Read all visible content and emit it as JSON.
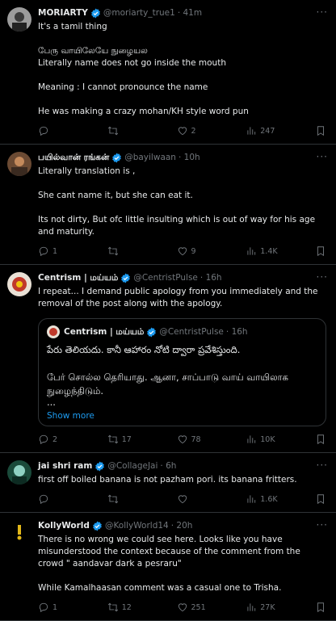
{
  "tweets": [
    {
      "name": "MORIARTY",
      "handle": "@moriarty_true1",
      "time": "· 41m",
      "lines": [
        "It's a tamil thing",
        "",
        "பேரு வாயிலேயே நுழையல",
        "Literally name does not go inside the mouth",
        "",
        "Meaning : I cannot pronounce the name",
        "",
        "He was making a crazy mohan/KH style word pun"
      ],
      "replies": "",
      "retweets": "",
      "likes": "2",
      "views": "247"
    },
    {
      "name": "பயில்வான் ரங்கன்",
      "handle": "@bayilwaan",
      "time": "· 10h",
      "lines": [
        "Literally translation is ,",
        "",
        "She cant name it, but she can eat it.",
        "",
        "Its not dirty, But ofc little insulting which is out of way for his age and maturity."
      ],
      "replies": "1",
      "retweets": "",
      "likes": "9",
      "views": "1.4K"
    },
    {
      "name": "Centrism | மய்யம்",
      "handle": "@CentristPulse",
      "time": "· 16h",
      "lines": [
        "I repeat... I demand public apology from you immediately and the removal of the post along with the apology."
      ],
      "quote": {
        "name": "Centrism | மய்யம்",
        "handle": "@CentristPulse",
        "time": "· 16h",
        "lines": [
          "పేరు తెలియదు. కానీ ఆహారం నోటి ద్వారా ప్రవేశిస్తుంది.",
          "",
          "பேர் சொல்ல தெரியாது. ஆனா, சாப்பாடு வாய் வாயிலாக",
          "நுழைந்திடும்.",
          "..."
        ],
        "show_more": "Show more"
      },
      "replies": "2",
      "retweets": "17",
      "likes": "78",
      "views": "10K"
    },
    {
      "name": "jai shri ram",
      "handle": "@CollageJai",
      "time": "· 6h",
      "lines": [
        "first off boiled banana is not pazham pori. its banana fritters."
      ],
      "replies": "",
      "retweets": "",
      "likes": "",
      "views": "1.6K"
    },
    {
      "name": "KollyWorld",
      "handle": "@KollyWorld14",
      "time": "· 20h",
      "lines": [
        "There is no wrong we could see here. Looks like you have misunderstood the context because of the comment from the crowd \" aandavar dark a pesraru\"",
        "",
        "While Kamalhaasan comment was a casual one to Trisha."
      ],
      "replies": "1",
      "retweets": "12",
      "likes": "251",
      "views": "27K"
    }
  ],
  "colors": {
    "accent": "#1d9bf0",
    "muted": "#71767b",
    "verified": "#1d9bf0",
    "gold": "#e2b719"
  },
  "icons": [
    "reply-icon",
    "retweet-icon",
    "like-icon",
    "views-icon",
    "bookmark-icon",
    "verified-icon",
    "more-icon"
  ]
}
